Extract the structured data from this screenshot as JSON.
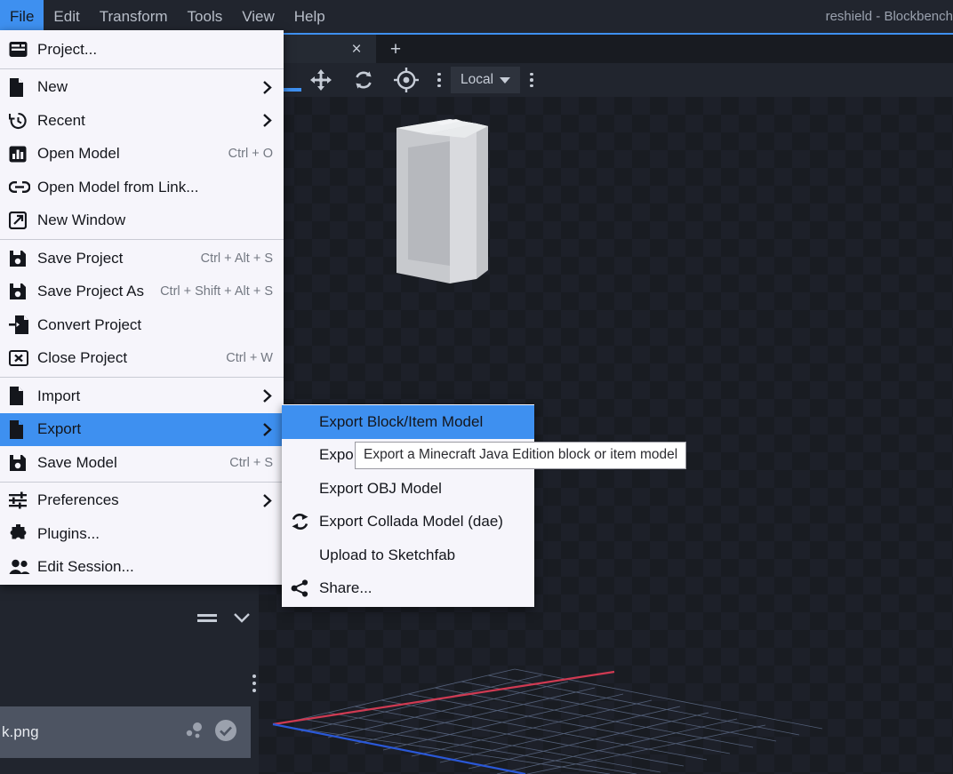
{
  "window": {
    "title": "reshield - Blockbench"
  },
  "menubar": {
    "items": [
      {
        "label": "File",
        "active": true
      },
      {
        "label": "Edit",
        "active": false
      },
      {
        "label": "Transform",
        "active": false
      },
      {
        "label": "Tools",
        "active": false
      },
      {
        "label": "View",
        "active": false
      },
      {
        "label": "Help",
        "active": false
      }
    ]
  },
  "tabbar": {
    "close_label": "×",
    "add_label": "+"
  },
  "toolbar": {
    "tools": [
      {
        "icon": "move-icon",
        "name": "move-tool"
      },
      {
        "icon": "rotate-icon",
        "name": "rotate-tool"
      },
      {
        "icon": "pivot-icon",
        "name": "pivot-tool"
      }
    ],
    "overflow_label": "⋮",
    "space_mode": "Local",
    "more_label": "⋮"
  },
  "file_menu": {
    "groups": [
      {
        "items": [
          {
            "label": "Project...",
            "icon": "project-icon",
            "shortcut": "",
            "submenu": false
          }
        ]
      },
      {
        "items": [
          {
            "label": "New",
            "icon": "file-icon",
            "shortcut": "",
            "submenu": true
          },
          {
            "label": "Recent",
            "icon": "history-icon",
            "shortcut": "",
            "submenu": true
          },
          {
            "label": "Open Model",
            "icon": "chart-icon",
            "shortcut": "Ctrl + O",
            "submenu": false
          },
          {
            "label": "Open Model from Link...",
            "icon": "link-icon",
            "shortcut": "",
            "submenu": false
          },
          {
            "label": "New Window",
            "icon": "external-link-icon",
            "shortcut": "",
            "submenu": false
          }
        ]
      },
      {
        "items": [
          {
            "label": "Save Project",
            "icon": "save-icon",
            "shortcut": "Ctrl + Alt + S",
            "submenu": false
          },
          {
            "label": "Save Project As",
            "icon": "save-icon",
            "shortcut": "Ctrl + Shift + Alt + S",
            "submenu": false
          },
          {
            "label": "Convert Project",
            "icon": "convert-icon",
            "shortcut": "",
            "submenu": false
          },
          {
            "label": "Close Project",
            "icon": "close-box-icon",
            "shortcut": "Ctrl + W",
            "submenu": false
          }
        ]
      },
      {
        "items": [
          {
            "label": "Import",
            "icon": "file-icon",
            "shortcut": "",
            "submenu": true
          },
          {
            "label": "Export",
            "icon": "file-icon",
            "shortcut": "",
            "submenu": true,
            "selected": true
          },
          {
            "label": "Save Model",
            "icon": "save-icon",
            "shortcut": "Ctrl + S",
            "submenu": false
          }
        ]
      },
      {
        "items": [
          {
            "label": "Preferences",
            "icon": "sliders-icon",
            "shortcut": "",
            "submenu": true
          },
          {
            "label": "Plugins...",
            "icon": "puzzle-icon",
            "shortcut": "",
            "submenu": false
          },
          {
            "label": "Edit Session...",
            "icon": "people-icon",
            "shortcut": "",
            "submenu": false
          }
        ]
      }
    ]
  },
  "export_submenu": {
    "items": [
      {
        "label": "Export Block/Item Model",
        "icon": "",
        "selected": true
      },
      {
        "label": "Expo",
        "icon": "",
        "selected": false
      },
      {
        "label": "Export OBJ Model",
        "icon": "",
        "selected": false
      },
      {
        "label": "Export Collada Model (dae)",
        "icon": "refresh-icon",
        "selected": false
      },
      {
        "label": "Upload to Sketchfab",
        "icon": "",
        "selected": false
      },
      {
        "label": "Share...",
        "icon": "share-icon",
        "selected": false
      }
    ]
  },
  "tooltip": {
    "text": "Export a Minecraft Java Edition block or item model"
  },
  "sidebar": {
    "panel_header_icons": [
      "list-icon",
      "chevron-down-icon"
    ],
    "overflow_label": "⋮",
    "texture": {
      "name": "k.png",
      "icons": [
        "particle-icon",
        "check-circle-icon"
      ]
    }
  },
  "colors": {
    "accent": "#3e90f0",
    "menu_bg": "#f6f5fb",
    "dark_bg": "#21252e",
    "viewport_bg": "#191c22",
    "axis_x": "#d03a52",
    "axis_z": "#2a58d8"
  }
}
